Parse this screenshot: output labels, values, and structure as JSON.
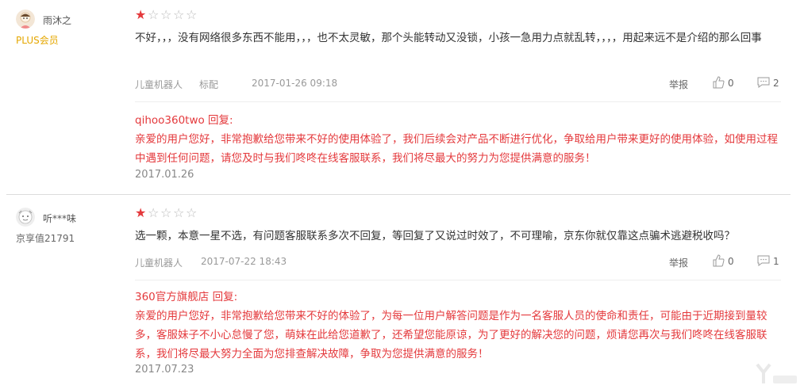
{
  "reviews": [
    {
      "user": {
        "name": "雨沐之",
        "level": "PLUS会员"
      },
      "stars": [
        1,
        0,
        0,
        0,
        0
      ],
      "content": "不好，，，没有网络很多东西不能用，，，也不太灵敏，那个头能转动又没锁，小孩一急用力点就乱转，，，，用起来远不是介绍的那么回事",
      "meta": {
        "product": "儿童机器人",
        "spec": "标配",
        "time": "2017-01-26 09:18",
        "report": "举报",
        "likes": "0",
        "comments": "2"
      },
      "reply": {
        "author": "qihoo360two",
        "suffix": " 回复:",
        "text": "亲爱的用户您好，非常抱歉给您带来不好的使用体验了，我们后续会对产品不断进行优化，争取给用户带来更好的使用体验，如使用过程中遇到任何问题，请您及时与我们咚咚在线客服联系，我们将尽最大的努力为您提供满意的服务！",
        "date": "2017.01.26"
      }
    },
    {
      "user": {
        "name": "听***味",
        "level": "京享值21791"
      },
      "stars": [
        1,
        0,
        0,
        0,
        0
      ],
      "content": "选一颗，本意一星不选，有问题客服联系多次不回复，等回复了又说过时效了，不可理喻，京东你就仅靠这点骗术逃避税收吗？",
      "meta": {
        "product": "儿童机器人",
        "time": "2017-07-22 18:43",
        "report": "举报",
        "likes": "0",
        "comments": "1"
      },
      "reply": {
        "author": "360官方旗舰店",
        "suffix": " 回复:",
        "text": "亲爱的用户您好，非常抱歉给您带来不好的体验了，为每一位用户解答问题是作为一名客服人员的使命和责任，可能由于近期接到量较多，客服妹子不小心怠慢了您，萌妹在此给您道歉了，还希望您能原谅，为了更好的解决您的问题，烦请您再次与我们咚咚在线客服联系，我们将尽最大努力全面为您排查解决故障，争取为您提供满意的服务！",
        "date": "2017.07.23"
      }
    }
  ],
  "colors": {
    "accent": "#e4393c",
    "plus": "#e5a700",
    "muted": "#999999"
  },
  "icons": {
    "star_on": "★",
    "star_off": "☆",
    "thumb": "thumb-up-icon",
    "comment": "comment-bubble-icon"
  }
}
